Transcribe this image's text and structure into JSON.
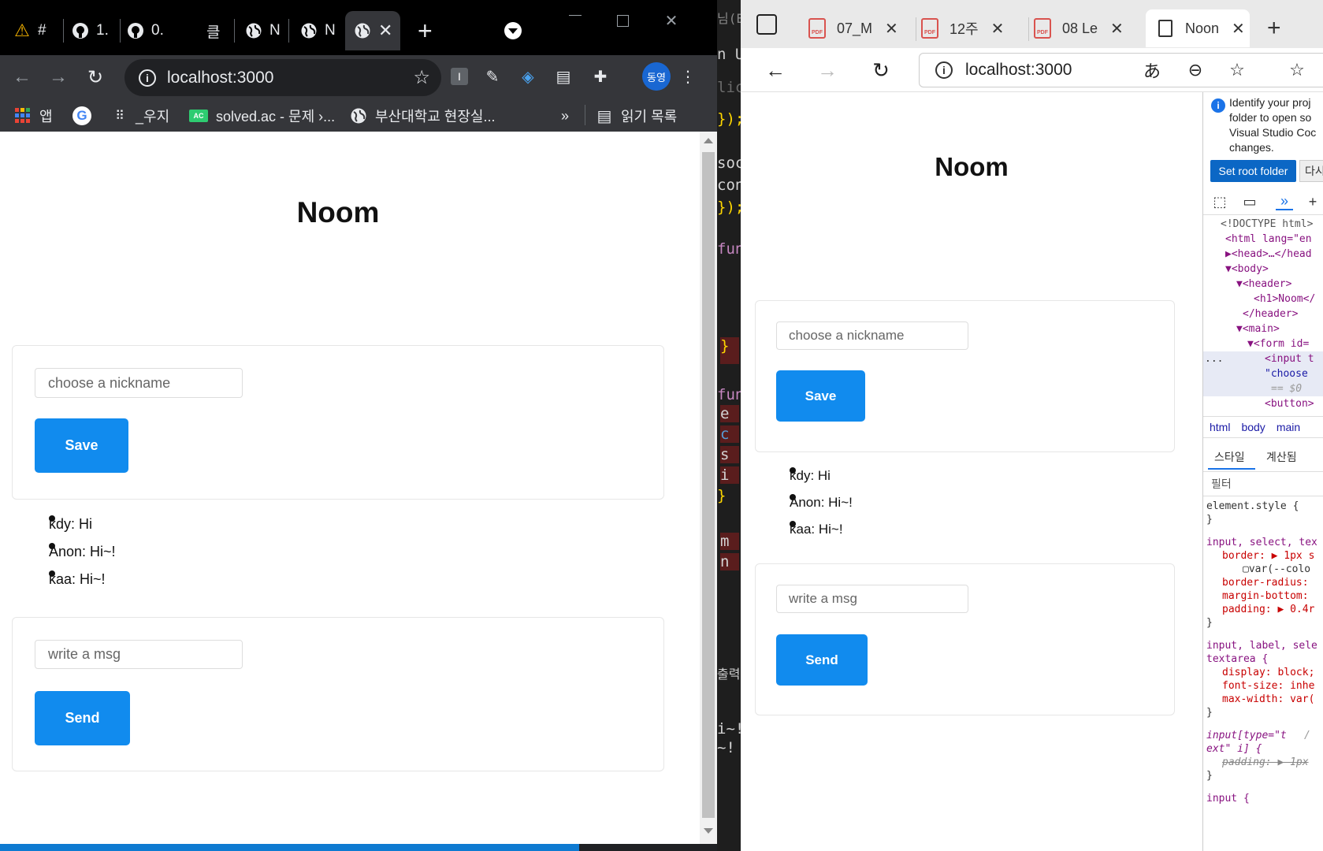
{
  "left_browser": {
    "tabs": [
      {
        "label": "#",
        "icon": "warning-triangle-icon"
      },
      {
        "label": "1.",
        "icon": "github-icon"
      },
      {
        "label": "0.",
        "icon": "github-icon"
      },
      {
        "label": "클",
        "icon": "page-icon"
      },
      {
        "label": "N",
        "icon": "globe-icon"
      },
      {
        "label": "N",
        "icon": "globe-icon"
      },
      {
        "label": "",
        "icon": "globe-icon"
      }
    ],
    "new_tab": "+",
    "url": "localhost:3000",
    "profile": "동영",
    "bookmarks": [
      {
        "label": "앱",
        "icon": "apps-grid-icon"
      },
      {
        "label": "",
        "icon": "google-icon"
      },
      {
        "label": "_우지",
        "icon": "dots-icon"
      },
      {
        "label": "solved.ac - 문제 ›...",
        "icon": "solvedac-icon"
      },
      {
        "label": "부산대학교 현장실...",
        "icon": "globe-icon"
      }
    ],
    "bookmark_overflow": "»",
    "reading_list": "읽기 목록"
  },
  "page": {
    "title": "Noom",
    "nickname_placeholder": "choose a nickname",
    "save_label": "Save",
    "messages": [
      "kdy: Hi",
      "Anon: Hi~!",
      "kaa: Hi~!"
    ],
    "msg_placeholder": "write a msg",
    "send_label": "Send"
  },
  "vscode_fragments": [
    {
      "text": "n U",
      "color": "#cccccc"
    },
    {
      "text": "lic",
      "color": "#6a6a6a"
    },
    {
      "text": "});",
      "color": "#ffd700"
    },
    {
      "text": "soc",
      "color": "#d4d4d4"
    },
    {
      "text": "con",
      "color": "#d4d4d4"
    },
    {
      "text": "});",
      "color": "#ffd700"
    },
    {
      "text": "fun",
      "color": "#c586c0"
    },
    {
      "text": "}",
      "color": "#ffd700"
    },
    {
      "text": "fun",
      "color": "#c586c0"
    },
    {
      "text": "e",
      "color": "#d4d4d4"
    },
    {
      "text": "c",
      "color": "#569cd6"
    },
    {
      "text": "s",
      "color": "#d4d4d4"
    },
    {
      "text": "i",
      "color": "#d4d4d4"
    },
    {
      "text": "}",
      "color": "#ffd700"
    },
    {
      "text": "m",
      "color": "#d4d4d4"
    },
    {
      "text": "n",
      "color": "#d4d4d4"
    },
    {
      "text": "출력",
      "color": "#cccccc"
    },
    {
      "text": "i~!",
      "color": "#d4d4d4"
    },
    {
      "text": "~!",
      "color": "#d4d4d4"
    },
    {
      "text": "님(E)",
      "color": "#888888"
    }
  ],
  "right_browser": {
    "tabs": [
      {
        "label": "07_M",
        "icon": "pdf-icon"
      },
      {
        "label": "12주",
        "icon": "pdf-icon"
      },
      {
        "label": "08 Le",
        "icon": "pdf-icon"
      },
      {
        "label": "Noon",
        "icon": "page-icon"
      }
    ],
    "new_tab": "+",
    "url": "localhost:3000",
    "pdf_badge": "PDF"
  },
  "devtools": {
    "notice_lines": [
      "Identify your proj",
      "folder to open so",
      "Visual Studio Coc",
      "changes."
    ],
    "set_root": "Set root folder",
    "dismiss": "다시",
    "dom_lines": [
      "<!DOCTYPE html>",
      "<html lang=\"en",
      "▶<head>…</head",
      "▼<body>",
      "▼<header>",
      "<h1>Noom</",
      "</header>",
      "▼<main>",
      "▼<form id=",
      "<input t",
      "\"choose",
      "== $0",
      "<button>"
    ],
    "dom_ellipsis": "...",
    "crumbs": [
      "html",
      "body",
      "main"
    ],
    "style_tabs": [
      "스타일",
      "계산됨"
    ],
    "filter": "필터",
    "style_rules": [
      "element.style {",
      "}",
      "input, select, tex",
      "border: ▶ 1px s",
      "▢var(--colo",
      "border-radius:",
      "margin-bottom:",
      "padding: ▶ 0.4r",
      "}",
      "input, label, sele",
      "textarea {",
      "display: block;",
      "font-size: inhe",
      "max-width: var(",
      "}",
      "input[type=\"t",
      "ext\" i] {",
      "padding: ▶ 1px",
      "}",
      "input {"
    ],
    "style_origin": "/"
  },
  "colors": {
    "accent": "#118bee",
    "chrome_dark": "#202124",
    "edge_blue": "#0b67c5"
  }
}
